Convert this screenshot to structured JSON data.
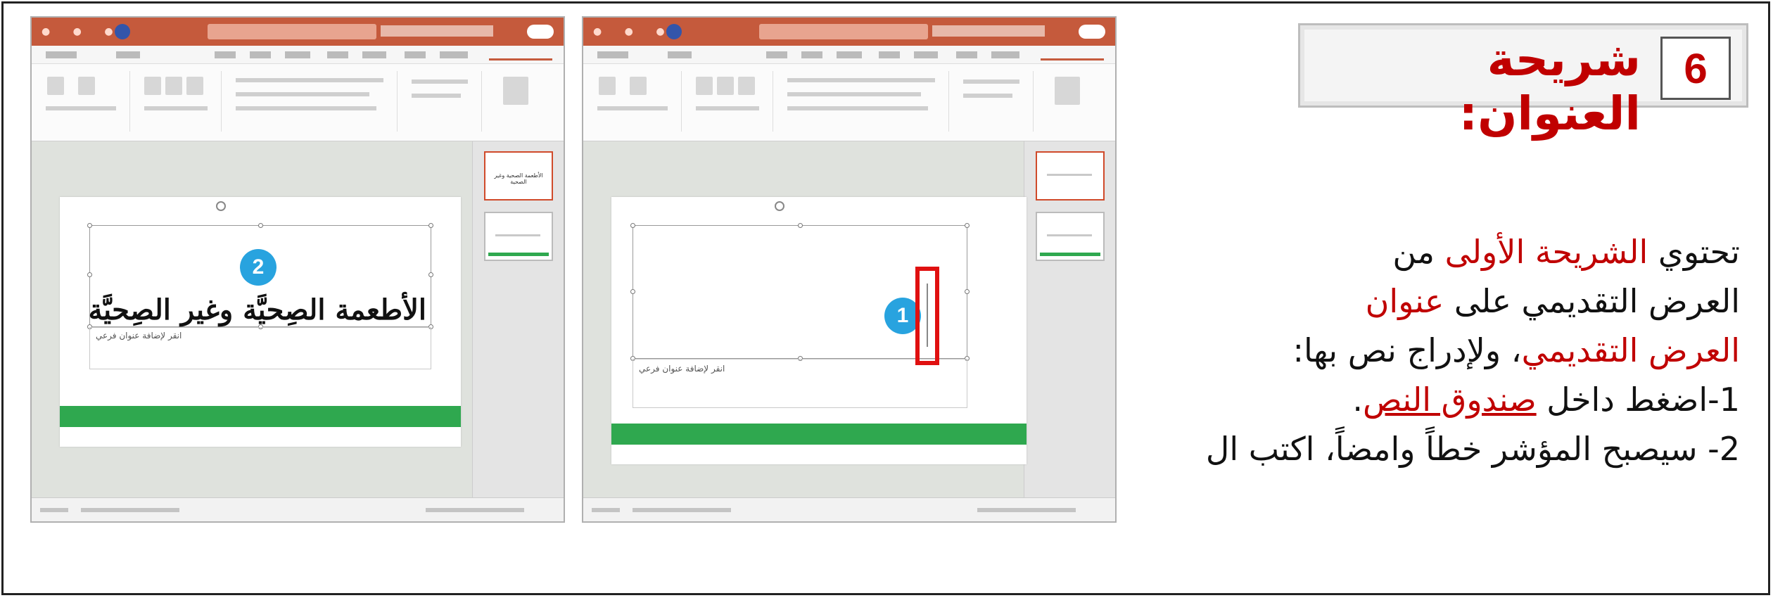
{
  "heading": {
    "number": "6",
    "title": "شريحة العنوان:"
  },
  "body": {
    "line1_pre": "تحتوي ",
    "line1_red": "الشريحة الأولى",
    "line1_post": " من",
    "line2_pre": "العرض التقديمي على ",
    "line2_red": "عنوان",
    "line3_red": "العرض التقديمي",
    "line3_post": "، ولإدراج نص بها:",
    "step1_pre": "1-اضغط داخل ",
    "step1_link": "صندوق النص",
    "step1_post": ".",
    "step2": "2- سيصبح المؤشر خطاً وامضاً، اكتب ال"
  },
  "screenshot_a": {
    "slide_title": "الأطعمة الصِحيَّة وغير الصِحيَّة",
    "subtitle_placeholder": "انقر لإضافة عنوان فرعي",
    "marker": "2",
    "thumb_text": "الأطعمة الصحية وغير الصحية"
  },
  "screenshot_b": {
    "subtitle_placeholder": "انقر لإضافة عنوان فرعي",
    "marker": "1"
  },
  "colors": {
    "accent_red": "#c00000",
    "powerpoint_orange": "#c55a3c",
    "marker_blue": "#28a3df",
    "slide_green": "#2fa84f",
    "highlight_red": "#e01010"
  },
  "icons": [
    "presentation-window",
    "marker-pin",
    "cursor-highlight"
  ]
}
